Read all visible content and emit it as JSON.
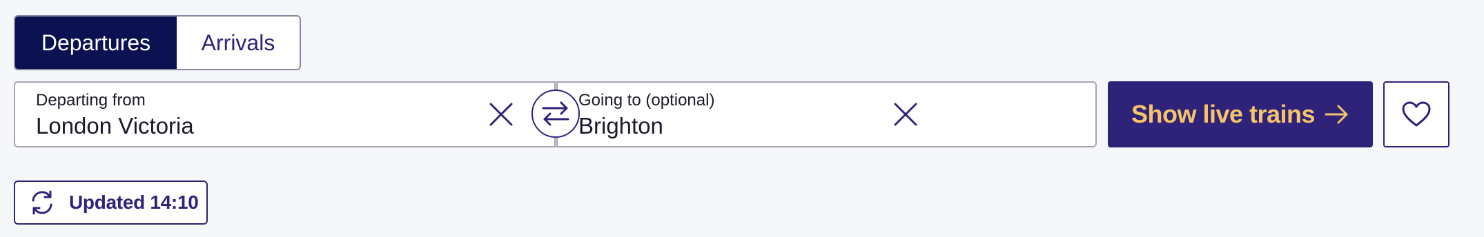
{
  "tabs": [
    {
      "label": "Departures",
      "selected": true
    },
    {
      "label": "Arrivals",
      "selected": false
    }
  ],
  "from_field": {
    "label": "Departing from",
    "value": "London Victoria",
    "clear_icon": "close-icon"
  },
  "to_field": {
    "label": "Going to (optional)",
    "value": "Brighton",
    "clear_icon": "close-icon"
  },
  "swap": {
    "icon": "swap-arrows-icon"
  },
  "show_button": {
    "label": "Show live trains",
    "icon": "arrow-right-icon"
  },
  "favourite": {
    "icon": "heart-icon"
  },
  "updated": {
    "label": "Updated 14:10",
    "icon": "refresh-icon"
  },
  "colors": {
    "navy": "#0b1151",
    "brand_purple": "#2e2378",
    "accent_yellow": "#f7c46a",
    "background": "#f5f7fa"
  }
}
